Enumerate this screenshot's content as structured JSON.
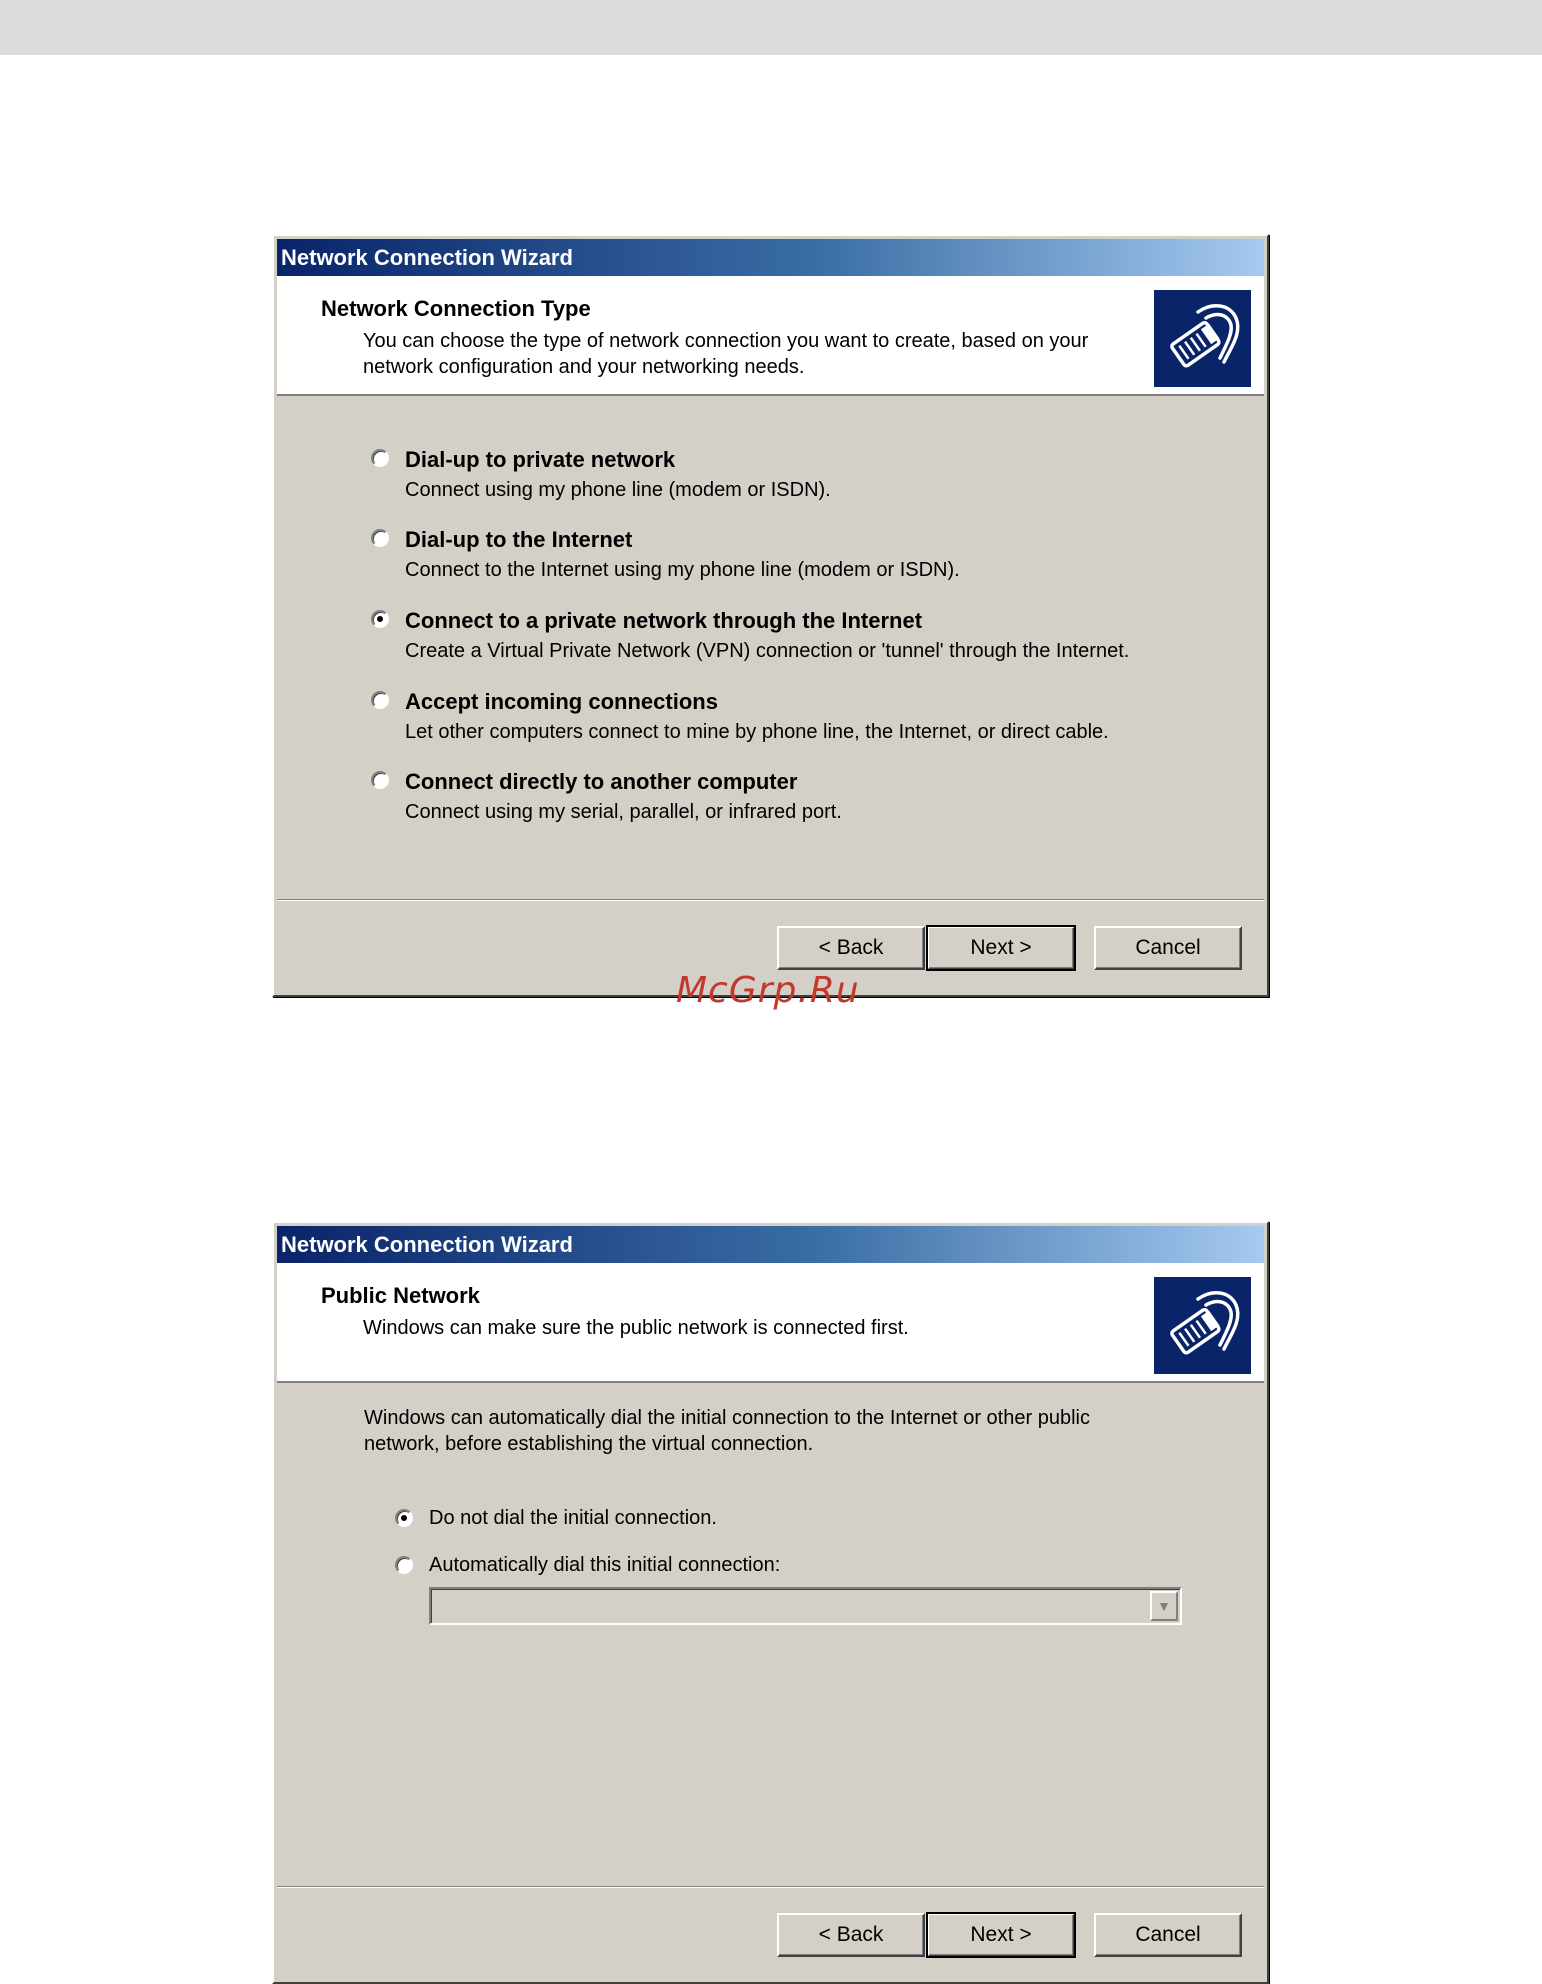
{
  "watermark": "McGrp.Ru",
  "dialog1": {
    "window_title": "Network Connection Wizard",
    "header_title": "Network Connection Type",
    "header_subtitle": "You can choose the type of network connection you want to create, based on your network configuration and your networking needs.",
    "icon": "network-cable-icon",
    "options": [
      {
        "label": "Dial-up to private network",
        "description": "Connect using my phone line (modem or ISDN).",
        "checked": false
      },
      {
        "label": "Dial-up to the Internet",
        "description": "Connect to the Internet using my phone line (modem or ISDN).",
        "checked": false
      },
      {
        "label": "Connect to a private network through the Internet",
        "description": "Create a Virtual Private Network (VPN) connection or 'tunnel' through the Internet.",
        "checked": true
      },
      {
        "label": "Accept incoming connections",
        "description": "Let other computers connect to mine by phone line, the Internet, or direct cable.",
        "checked": false
      },
      {
        "label": "Connect directly to another computer",
        "description": "Connect using my serial, parallel, or infrared port.",
        "checked": false
      }
    ],
    "buttons": {
      "back": "< Back",
      "next": "Next >",
      "cancel": "Cancel"
    }
  },
  "dialog2": {
    "window_title": "Network Connection Wizard",
    "header_title": "Public Network",
    "header_subtitle": "Windows can make sure the public network is connected first.",
    "icon": "network-cable-icon",
    "body_text": "Windows can automatically dial the initial connection to the Internet or other public network, before establishing the virtual connection.",
    "options": [
      {
        "label": "Do not dial the initial connection.",
        "checked": true
      },
      {
        "label": "Automatically dial this initial connection:",
        "checked": false
      }
    ],
    "combo_value": "",
    "buttons": {
      "back": "< Back",
      "next": "Next >",
      "cancel": "Cancel"
    }
  }
}
